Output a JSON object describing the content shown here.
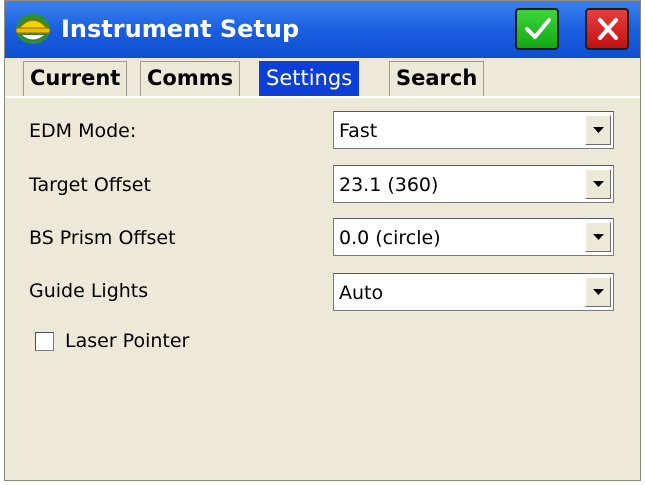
{
  "window": {
    "title": "Instrument Setup",
    "app_icon": "surveyor-helmet-icon",
    "ok_icon": "checkmark-icon",
    "cancel_icon": "close-icon",
    "colors": {
      "titlebar": "#1a5fe0",
      "ok": "#22c022",
      "cancel": "#d42020",
      "active_tab": "#0b3fd8"
    }
  },
  "tabs": [
    {
      "label": "Current"
    },
    {
      "label": "Comms"
    },
    {
      "label": "Settings"
    },
    {
      "label": "Search"
    }
  ],
  "active_tab": "Settings",
  "settings": {
    "edm_mode": {
      "label": "EDM Mode:",
      "value": "Fast"
    },
    "target_offset": {
      "label": "Target Offset",
      "value": "23.1 (360)"
    },
    "bs_prism_offset": {
      "label": "BS Prism Offset",
      "value": "0.0 (circle)"
    },
    "guide_lights": {
      "label": "Guide Lights",
      "value": "Auto"
    },
    "laser_pointer": {
      "label": "Laser Pointer",
      "checked": false
    }
  }
}
